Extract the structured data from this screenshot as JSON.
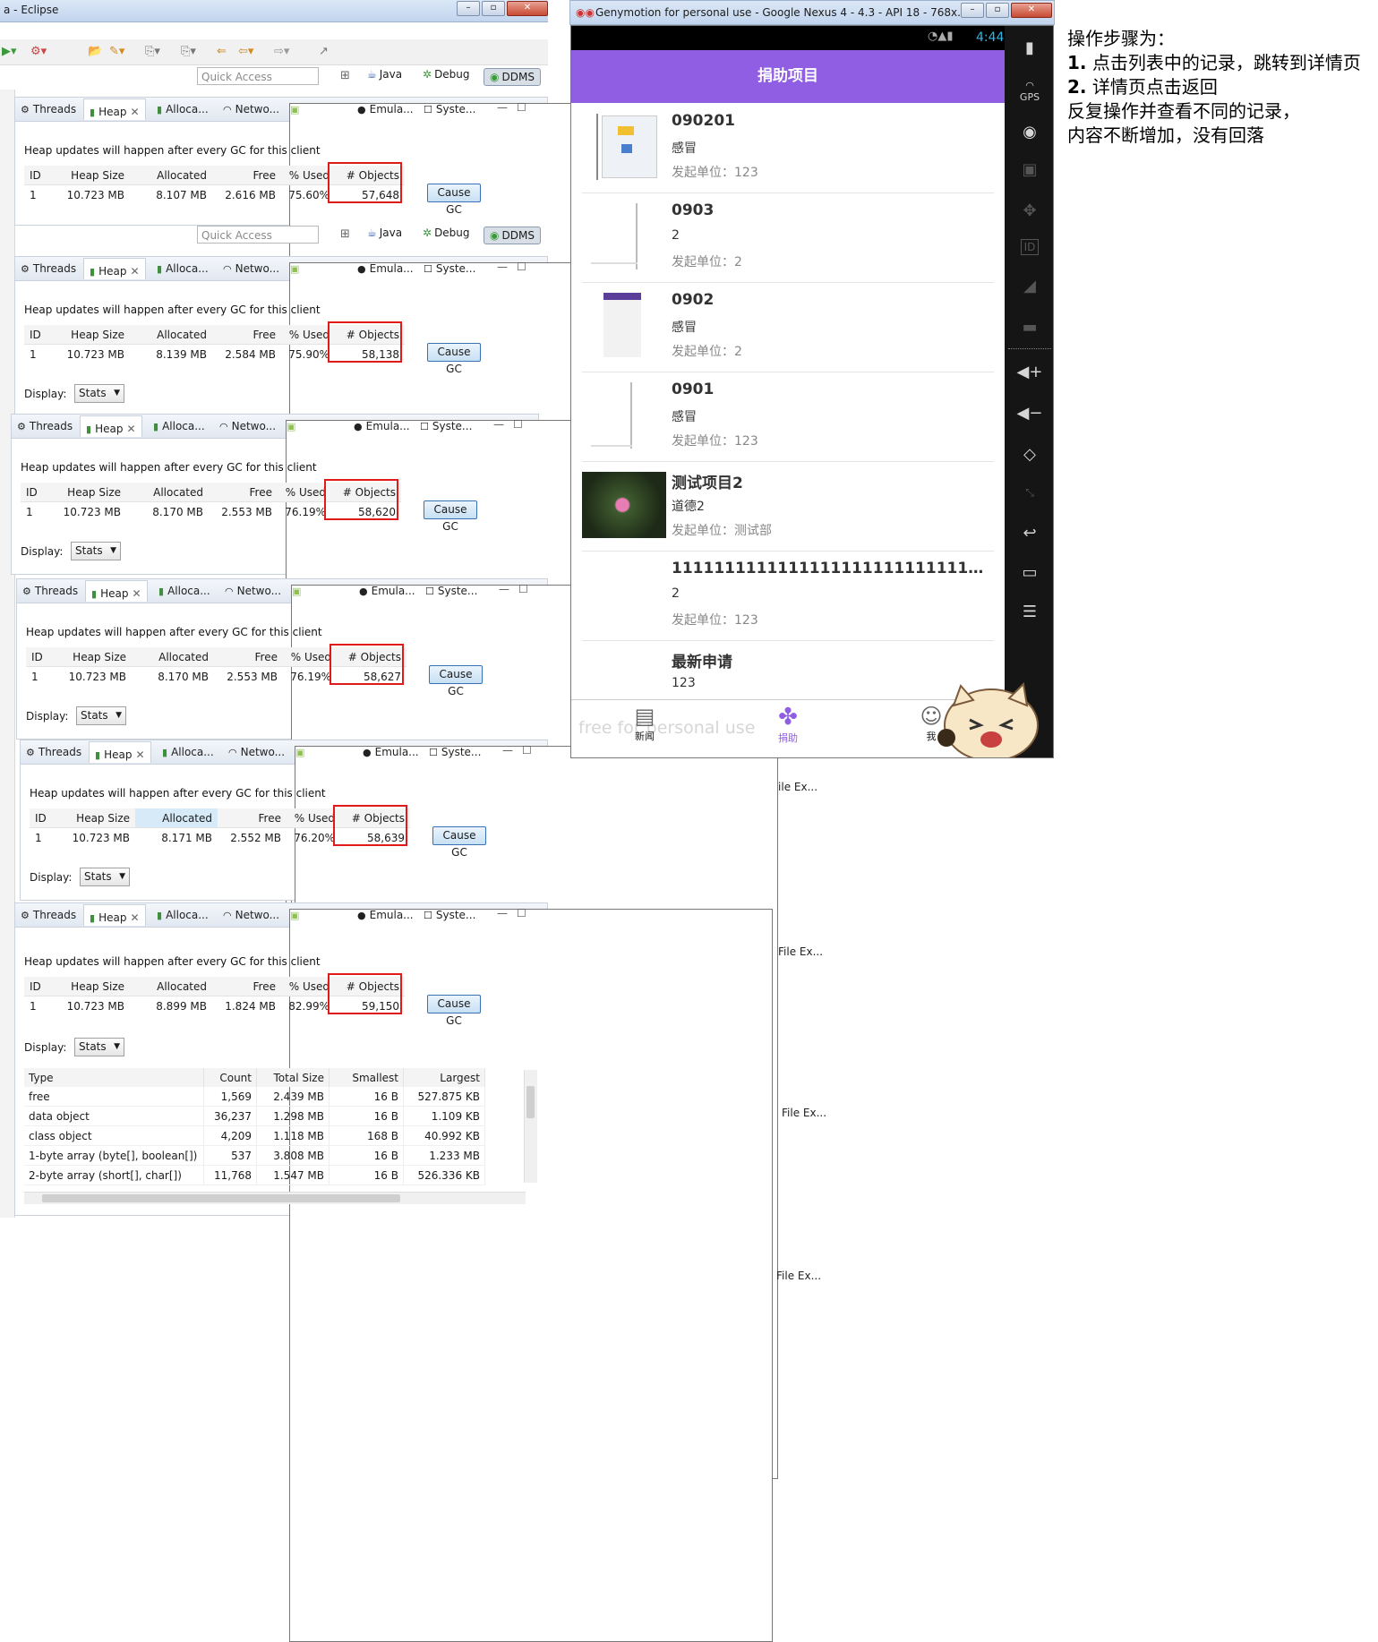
{
  "eclipse": {
    "title": "a - Eclipse",
    "quick_access": "Quick Access",
    "perspectives": [
      "Java",
      "Debug",
      "DDMS"
    ]
  },
  "tabs": [
    "Threads",
    "Heap",
    "Alloca...",
    "Netwo...",
    "File Ex...",
    "Emula...",
    "Syste..."
  ],
  "heap_message": "Heap updates will happen after every GC for this client",
  "heap_columns": [
    "ID",
    "Heap Size",
    "Allocated",
    "Free",
    "% Used",
    "# Objects"
  ],
  "cause_gc_label": "Cause GC",
  "display_label": "Display:",
  "display_value": "Stats",
  "snapshots": [
    {
      "row": [
        "1",
        "10.723 MB",
        "8.107 MB",
        "2.616 MB",
        "75.60%",
        "57,648"
      ]
    },
    {
      "row": [
        "1",
        "10.723 MB",
        "8.139 MB",
        "2.584 MB",
        "75.90%",
        "58,138"
      ]
    },
    {
      "row": [
        "1",
        "10.723 MB",
        "8.170 MB",
        "2.553 MB",
        "76.19%",
        "58,620"
      ]
    },
    {
      "row": [
        "1",
        "10.723 MB",
        "8.170 MB",
        "2.553 MB",
        "76.19%",
        "58,627"
      ]
    },
    {
      "row": [
        "1",
        "10.723 MB",
        "8.171 MB",
        "2.552 MB",
        "76.20%",
        "58,639"
      ]
    },
    {
      "row": [
        "1",
        "10.723 MB",
        "8.899 MB",
        "1.824 MB",
        "82.99%",
        "59,150"
      ]
    }
  ],
  "stats_table": {
    "columns": [
      "Type",
      "Count",
      "Total Size",
      "Smallest",
      "Largest"
    ],
    "rows": [
      [
        "free",
        "1,569",
        "2.439 MB",
        "16 B",
        "527.875 KB"
      ],
      [
        "data object",
        "36,237",
        "1.298 MB",
        "16 B",
        "1.109 KB"
      ],
      [
        "class object",
        "4,209",
        "1.118 MB",
        "168 B",
        "40.992 KB"
      ],
      [
        "1-byte array (byte[], boolean[])",
        "537",
        "3.808 MB",
        "16 B",
        "1.233 MB"
      ],
      [
        "2-byte array (short[], char[])",
        "11,768",
        "1.547 MB",
        "16 B",
        "526.336 KB"
      ]
    ]
  },
  "genymotion": {
    "title": "Genymotion for personal use - Google Nexus 4 - 4.3 - API 18 - 768x...",
    "time": "4:44",
    "app_title": "捐助项目",
    "list": [
      {
        "title": "090201",
        "sub": "感冒",
        "org": "发起单位：123"
      },
      {
        "title": "0903",
        "sub": "2",
        "org": "发起单位：2"
      },
      {
        "title": "0902",
        "sub": "感冒",
        "org": "发起单位：2"
      },
      {
        "title": "0901",
        "sub": "感冒",
        "org": "发起单位：123"
      },
      {
        "title": "测试项目2",
        "sub": "道德2",
        "org": "发起单位：测试部"
      },
      {
        "title": "11111111111111111111111111111111111...",
        "sub": "2",
        "org": "发起单位：123"
      },
      {
        "title": "最新申请",
        "sub": "123",
        "org": ""
      }
    ],
    "nav": [
      "新闻",
      "捐助",
      "我"
    ],
    "watermark": "free for personal use",
    "sidebar_labels": [
      "GPS",
      "ID"
    ]
  },
  "instructions": {
    "heading": "操作步骤为：",
    "step1_num": "1.",
    "step1": "点击列表中的记录，跳转到详情页",
    "step2_num": "2.",
    "step2": "详情页点击返回",
    "line3": "反复操作并查看不同的记录，",
    "line4": "内容不断增加，没有回落"
  },
  "colors": {
    "accent": "#8f5ee3",
    "highlight": "#e0191a",
    "status_time": "#33b5e5"
  }
}
